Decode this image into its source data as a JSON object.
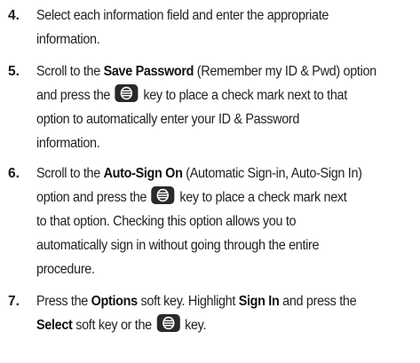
{
  "steps": [
    {
      "num": "4.",
      "lines": [
        [
          "Select each information field and enter the appropriate"
        ],
        [
          "information."
        ]
      ]
    },
    {
      "num": "5.",
      "line1_a": "Scroll to the ",
      "line1_b": "Save Password",
      "line1_c": " (Remember my ID & Pwd) option",
      "line2_a": "and press the",
      "line2_b": "key to place a check mark next to that",
      "line3": "option to automatically enter your ID & Password",
      "line4": "information."
    },
    {
      "num": "6.",
      "line1_a": "Scroll to the ",
      "line1_b": "Auto-Sign On",
      "line1_c": " (Automatic Sign-in, Auto-Sign In)",
      "line2_a": "option and press the",
      "line2_b": "key to place a check mark next",
      "line3": "to that option. Checking this option allows you to",
      "line4": "automatically sign in without going through the entire",
      "line5": "procedure."
    },
    {
      "num": "7.",
      "line1_a": "Press the ",
      "line1_b": "Options",
      "line1_c": " soft key. Highlight ",
      "line1_d": "Sign In",
      "line1_e": " and press the",
      "line2_a": "Select",
      "line2_b": " soft key or the",
      "line2_c": "key."
    }
  ],
  "icon": {
    "name": "ok-key-icon",
    "color": "#2a2a2a"
  }
}
